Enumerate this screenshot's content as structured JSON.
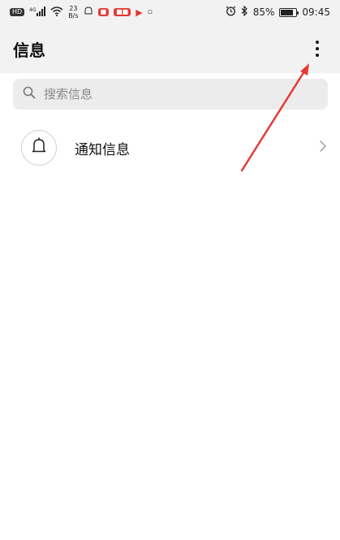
{
  "statusbar": {
    "hd_label": "HD",
    "signal_label": "4G",
    "net_speed_value": "23",
    "net_speed_unit": "B/s",
    "battery_percent": "85%",
    "battery_level": 0.85,
    "time": "09:45"
  },
  "appbar": {
    "title": "信息"
  },
  "search": {
    "placeholder": "搜索信息"
  },
  "list": {
    "items": [
      {
        "label": "通知信息"
      }
    ]
  },
  "colors": {
    "annotation_arrow": "#e53935",
    "header_bg": "#f2f2f2",
    "search_bg": "#ececec"
  }
}
